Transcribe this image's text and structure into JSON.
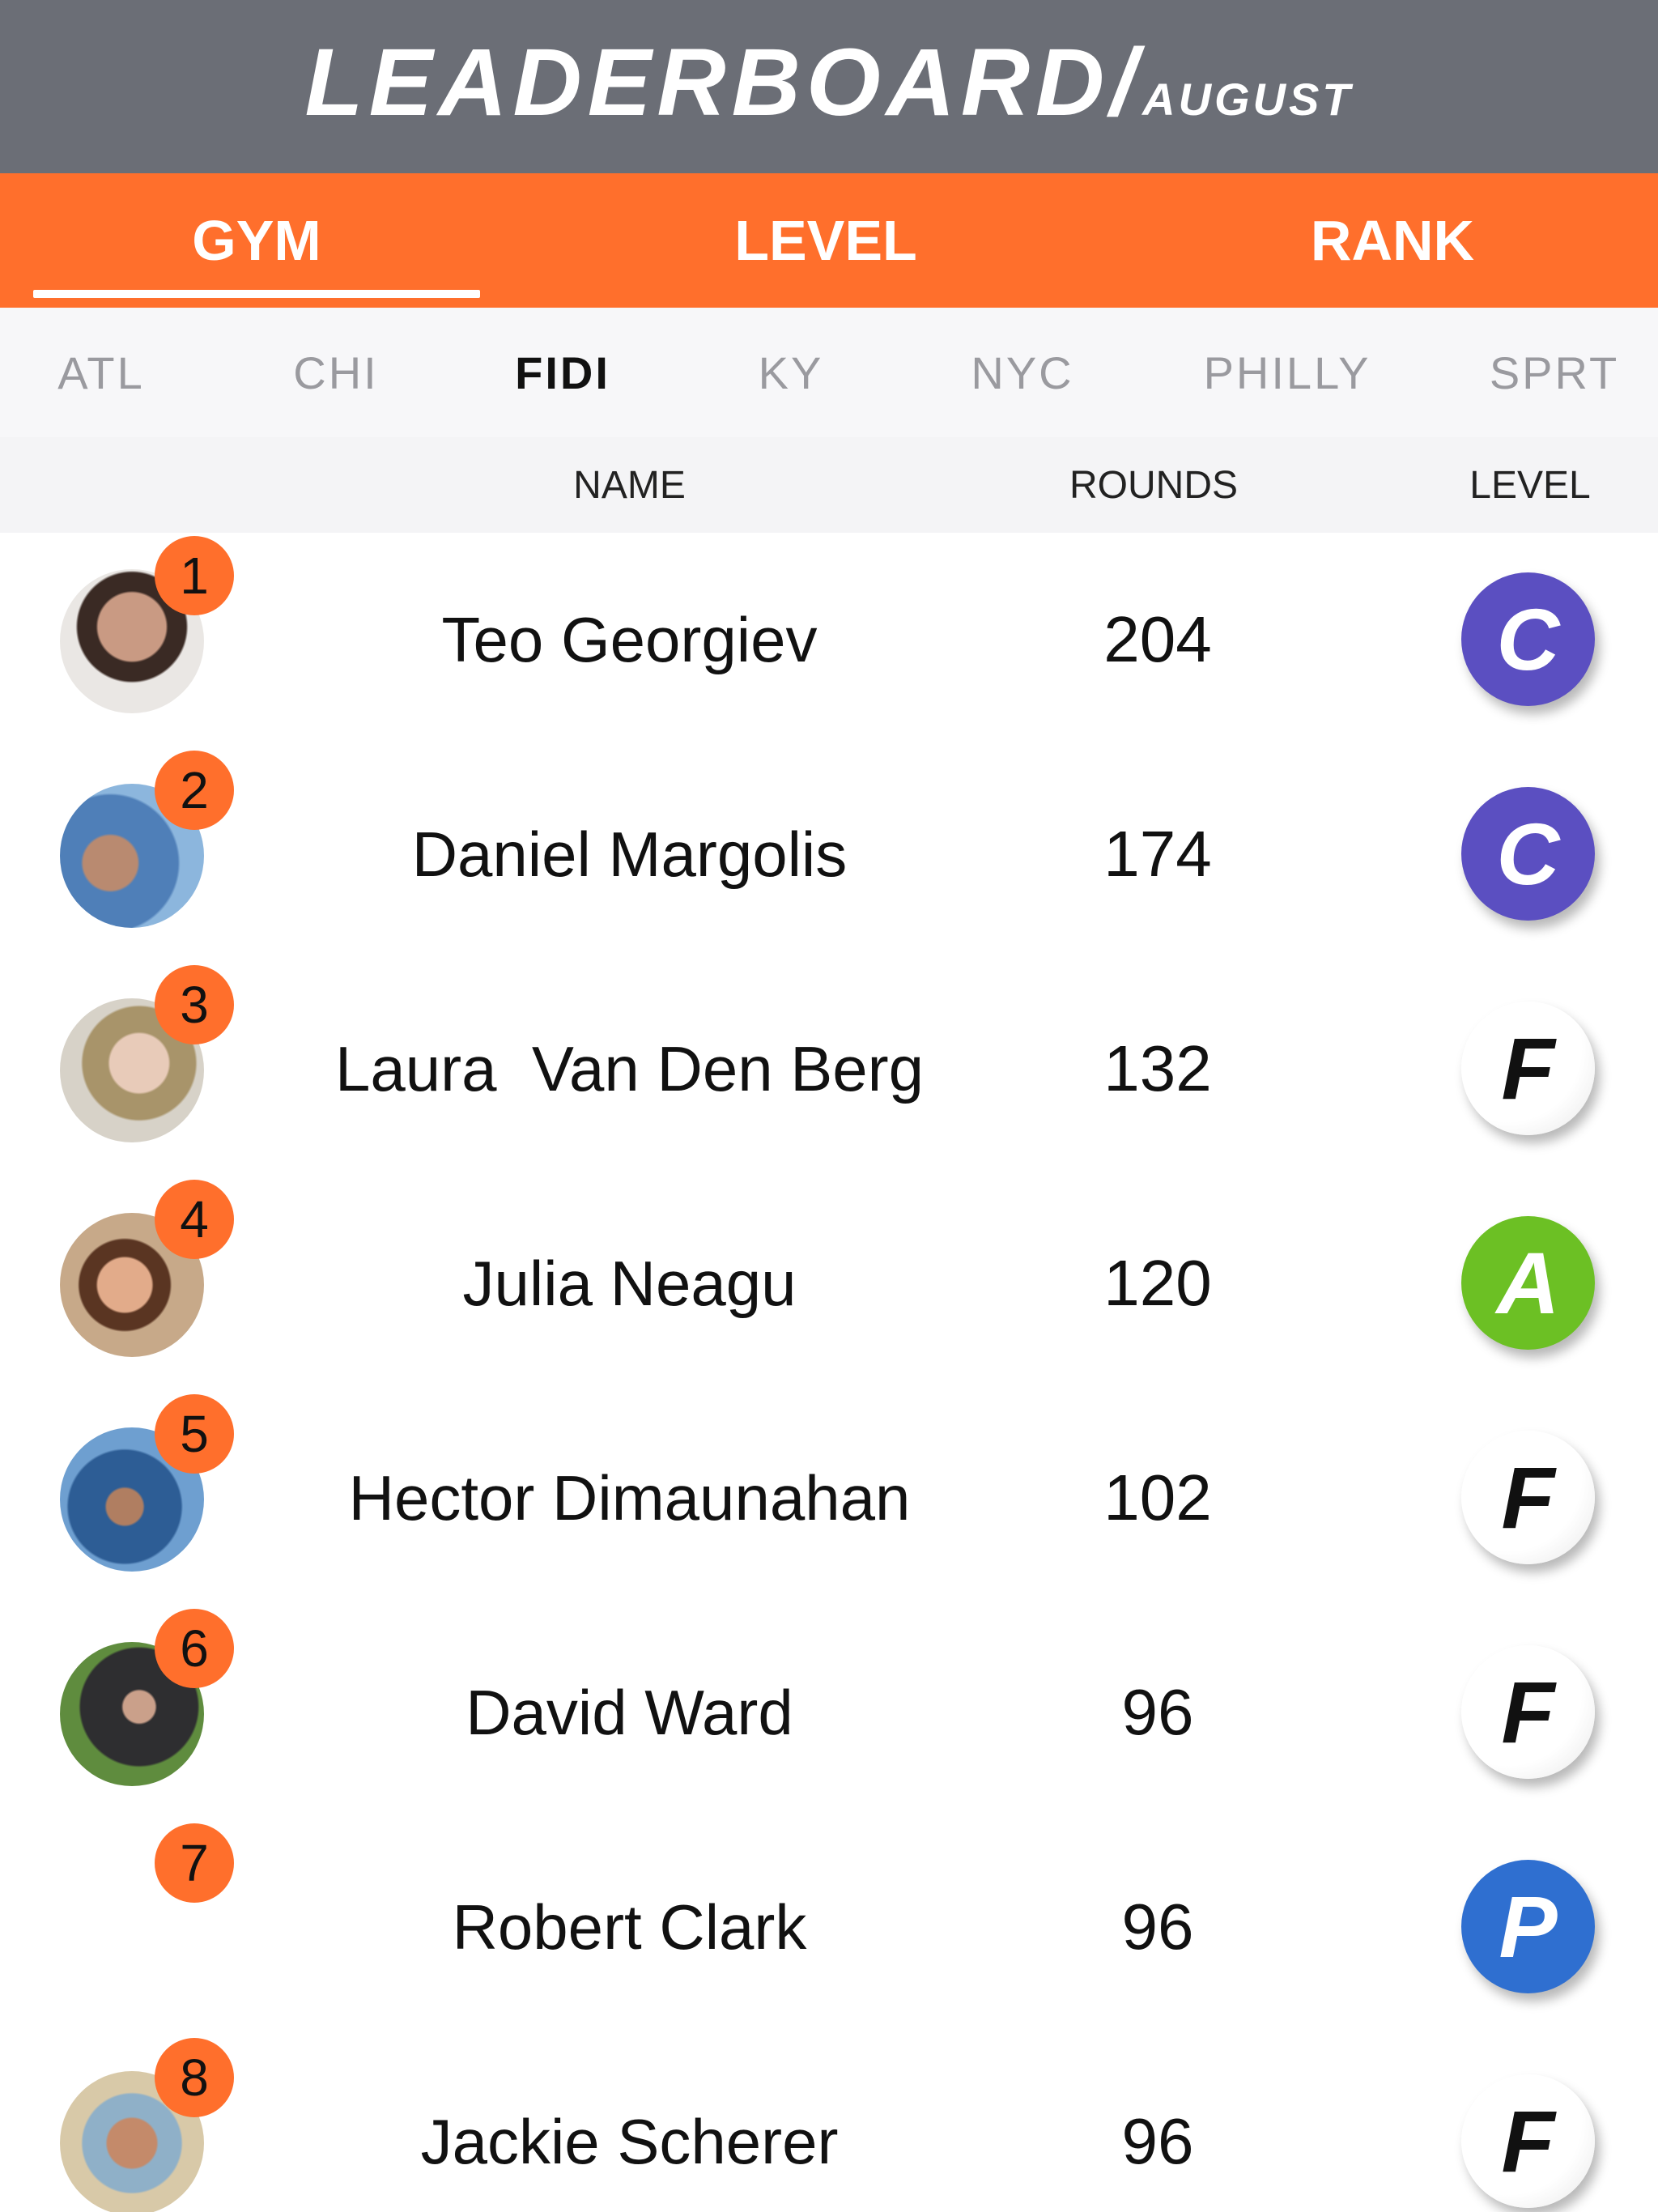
{
  "header": {
    "title": "LEADERBOARD/",
    "subtitle": "AUGUST"
  },
  "tabs": [
    {
      "label": "GYM",
      "active": true
    },
    {
      "label": "LEVEL",
      "active": false
    },
    {
      "label": "RANK",
      "active": false
    }
  ],
  "gyms": [
    {
      "label": "ATL",
      "active": false
    },
    {
      "label": "CHI",
      "active": false
    },
    {
      "label": "FIDI",
      "active": true
    },
    {
      "label": "KY",
      "active": false
    },
    {
      "label": "NYC",
      "active": false
    },
    {
      "label": "PHILLY",
      "active": false
    },
    {
      "label": "SPRT",
      "active": false
    }
  ],
  "columns": {
    "name": "NAME",
    "rounds": "ROUNDS",
    "level": "LEVEL"
  },
  "rows": [
    {
      "rank": "1",
      "name": "Teo Georgiev",
      "rounds": "204",
      "level": "C"
    },
    {
      "rank": "2",
      "name": "Daniel Margolis",
      "rounds": "174",
      "level": "C"
    },
    {
      "rank": "3",
      "name": "Laura  Van Den Berg",
      "rounds": "132",
      "level": "F"
    },
    {
      "rank": "4",
      "name": "Julia Neagu",
      "rounds": "120",
      "level": "A"
    },
    {
      "rank": "5",
      "name": "Hector Dimaunahan",
      "rounds": "102",
      "level": "F"
    },
    {
      "rank": "6",
      "name": "David Ward",
      "rounds": "96",
      "level": "F"
    },
    {
      "rank": "7",
      "name": "Robert Clark",
      "rounds": "96",
      "level": "P"
    },
    {
      "rank": "8",
      "name": "Jackie Scherer",
      "rounds": "96",
      "level": "F"
    }
  ],
  "colors": {
    "header_bg": "#6b6e76",
    "accent": "#ff6f2c",
    "level_C": "#5b4fc1",
    "level_A": "#6cc024",
    "level_P": "#2f6fd0",
    "level_F": "#ffffff"
  }
}
